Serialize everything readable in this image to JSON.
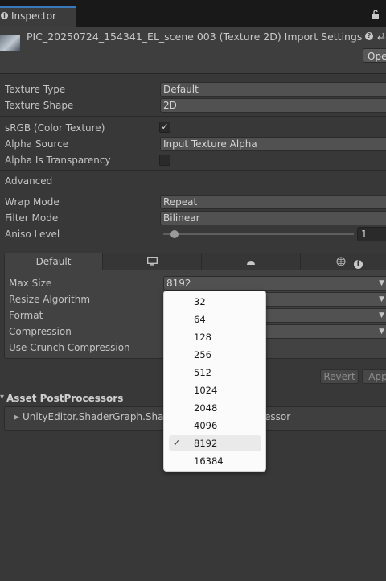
{
  "window": {
    "tab_label": "Inspector"
  },
  "header": {
    "title": "PIC_20250724_154341_EL_scene 003 (Texture 2D) Import Settings",
    "open_label": "Ope"
  },
  "fields": {
    "texture_type": {
      "label": "Texture Type",
      "value": "Default"
    },
    "texture_shape": {
      "label": "Texture Shape",
      "value": "2D"
    },
    "srgb": {
      "label": "sRGB (Color Texture)",
      "checked": true,
      "mark": "✓"
    },
    "alpha_source": {
      "label": "Alpha Source",
      "value": "Input Texture Alpha"
    },
    "alpha_transparency": {
      "label": "Alpha Is Transparency",
      "checked": false
    },
    "advanced": {
      "label": "Advanced"
    },
    "wrap_mode": {
      "label": "Wrap Mode",
      "value": "Repeat"
    },
    "filter_mode": {
      "label": "Filter Mode",
      "value": "Bilinear"
    },
    "aniso_level": {
      "label": "Aniso Level",
      "value": "1",
      "slider_fraction": 0.05
    }
  },
  "platform": {
    "tabs": [
      "Default",
      "monitor-icon",
      "android-icon",
      "web-facebook-icons"
    ],
    "default_label": "Default",
    "max_size": {
      "label": "Max Size",
      "value": "8192"
    },
    "resize_algorithm": {
      "label": "Resize Algorithm"
    },
    "format": {
      "label": "Format"
    },
    "compression": {
      "label": "Compression"
    },
    "crunch": {
      "label": "Use Crunch Compression"
    }
  },
  "buttons": {
    "revert": "Revert",
    "apply": "App"
  },
  "asset_postprocessors": {
    "title": "Asset PostProcessors",
    "item_start": "UnityEditor.ShaderGraph.Shade",
    "item_end": "essor"
  },
  "popup": {
    "selected": "8192",
    "check": "✓",
    "options": [
      "32",
      "64",
      "128",
      "256",
      "512",
      "1024",
      "2048",
      "4096",
      "8192",
      "16384"
    ]
  }
}
